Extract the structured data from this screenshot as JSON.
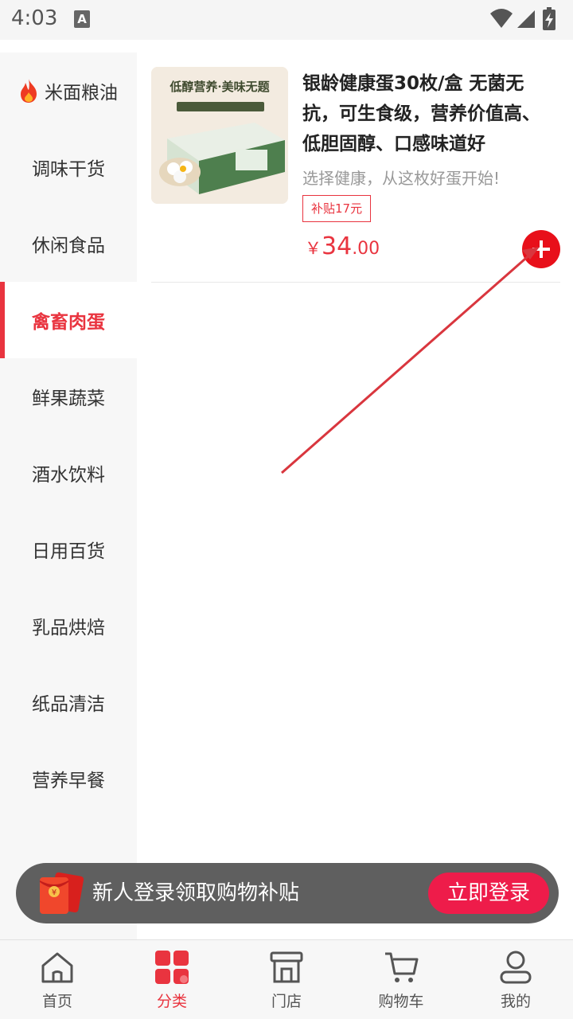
{
  "status_bar": {
    "time": "4:03",
    "notification_letter": "A",
    "icons": [
      "wifi-icon",
      "signal-icon",
      "battery-charging-icon"
    ]
  },
  "sidebar": {
    "items": [
      {
        "label": "米面粮油",
        "icon": "fire-icon",
        "active": false
      },
      {
        "label": "调味干货",
        "active": false
      },
      {
        "label": "休闲食品",
        "active": false
      },
      {
        "label": "禽畜肉蛋",
        "active": true
      },
      {
        "label": "鲜果蔬菜",
        "active": false
      },
      {
        "label": "酒水饮料",
        "active": false
      },
      {
        "label": "日用百货",
        "active": false
      },
      {
        "label": "乳品烘焙",
        "active": false
      },
      {
        "label": "纸品清洁",
        "active": false
      },
      {
        "label": "营养早餐",
        "active": false
      }
    ]
  },
  "product": {
    "image_caption": "低醇营养·美味无题",
    "title": "银龄健康蛋30枚/盒 无菌无抗，可生食级，营养价值高、低胆固醇、口感味道好",
    "subtitle": "选择健康，从这枚好蛋开始!",
    "badge": "补贴17元",
    "price_symbol": "￥",
    "price_int": "34",
    "price_dec": ".00"
  },
  "login_banner": {
    "text": "新人登录领取购物补贴",
    "button": "立即登录"
  },
  "bottom_nav": {
    "items": [
      {
        "label": "首页",
        "icon": "home-icon"
      },
      {
        "label": "分类",
        "icon": "category-icon",
        "active": true
      },
      {
        "label": "门店",
        "icon": "store-icon"
      },
      {
        "label": "购物车",
        "icon": "cart-icon"
      },
      {
        "label": "我的",
        "icon": "profile-icon"
      }
    ]
  },
  "colors": {
    "accent": "#e9343f",
    "add_button": "#e8101a",
    "login_button": "#ee1c4a",
    "banner_bg": "#5f5f5f"
  }
}
